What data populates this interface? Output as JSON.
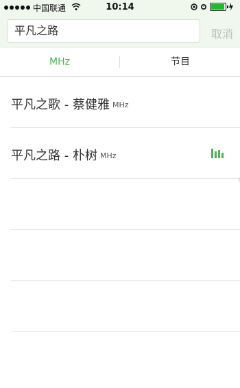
{
  "status_bar": {
    "carrier": "中国联通",
    "time": "10:14",
    "battery_level": 0.85,
    "signal_strength": 5,
    "colors": {
      "battery_fill": "#1bbd2c"
    }
  },
  "search": {
    "value": "平凡之路",
    "cancel_label": "取消"
  },
  "tabs": [
    {
      "label": "MHz",
      "active": true
    },
    {
      "label": "节目",
      "active": false
    }
  ],
  "results": [
    {
      "title": "平凡之歌 - 蔡健雅",
      "unit": "MHz"
    },
    {
      "title": "平凡之路 - 朴树",
      "unit": "MHz",
      "playing": true
    }
  ],
  "colors": {
    "accent": "#4fb34f",
    "header_bg": "#f0f7ed"
  }
}
